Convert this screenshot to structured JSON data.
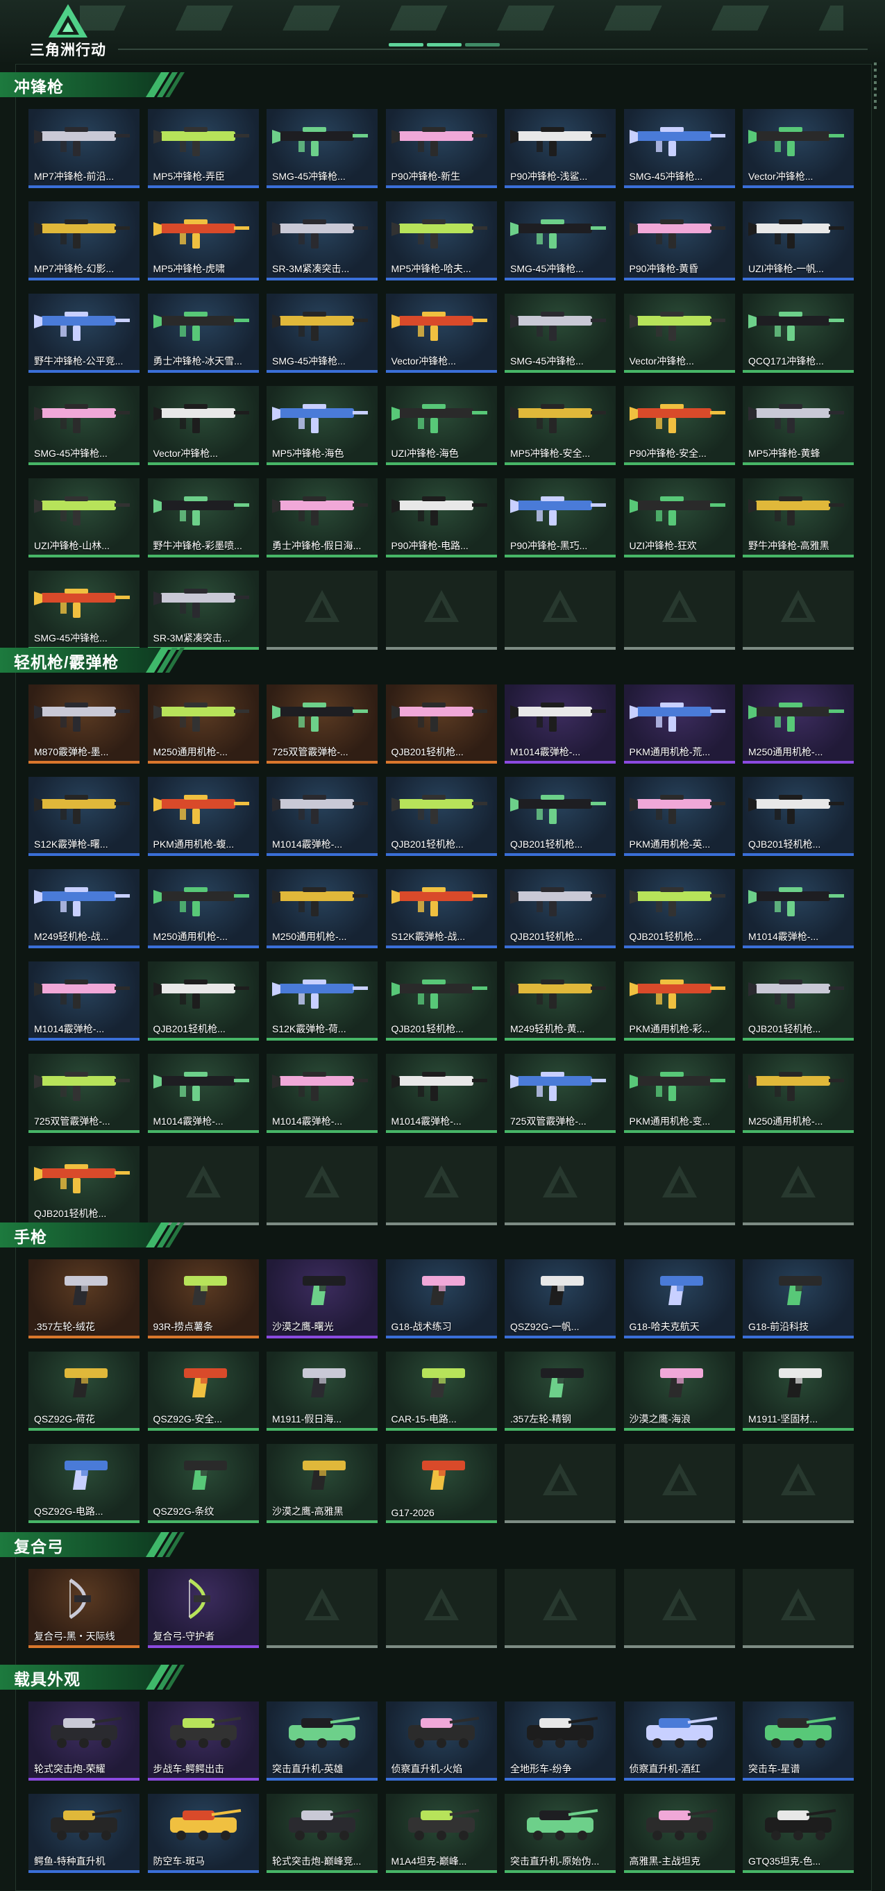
{
  "app": {
    "logo_text": "三角洲行动"
  },
  "colors": {
    "accent": "#47b667",
    "rarity_green": "#47b667",
    "rarity_blue": "#3a6fd8",
    "rarity_purple": "#8b4ae0",
    "rarity_orange": "#d9772c"
  },
  "sections": [
    {
      "title": "冲锋枪",
      "icon": "smg-icon",
      "slots": 42,
      "items": [
        {
          "label": "MP7冲锋枪-前沿...",
          "rarity": "blue"
        },
        {
          "label": "MP5冲锋枪-弄臣",
          "rarity": "blue"
        },
        {
          "label": "SMG-45冲锋枪...",
          "rarity": "blue"
        },
        {
          "label": "P90冲锋枪-新生",
          "rarity": "blue"
        },
        {
          "label": "P90冲锋枪-浅鲨...",
          "rarity": "blue"
        },
        {
          "label": "SMG-45冲锋枪...",
          "rarity": "blue"
        },
        {
          "label": "Vector冲锋枪...",
          "rarity": "blue"
        },
        {
          "label": "MP7冲锋枪-幻影...",
          "rarity": "blue"
        },
        {
          "label": "MP5冲锋枪-虎啸",
          "rarity": "blue"
        },
        {
          "label": "SR-3M紧凑突击...",
          "rarity": "blue"
        },
        {
          "label": "MP5冲锋枪-哈夫...",
          "rarity": "blue"
        },
        {
          "label": "SMG-45冲锋枪...",
          "rarity": "blue"
        },
        {
          "label": "P90冲锋枪-黄昏",
          "rarity": "blue"
        },
        {
          "label": "UZI冲锋枪-一帆...",
          "rarity": "blue"
        },
        {
          "label": "野牛冲锋枪-公平竞...",
          "rarity": "blue"
        },
        {
          "label": "勇士冲锋枪-冰天雪...",
          "rarity": "blue"
        },
        {
          "label": "SMG-45冲锋枪...",
          "rarity": "blue"
        },
        {
          "label": "Vector冲锋枪...",
          "rarity": "blue"
        },
        {
          "label": "SMG-45冲锋枪...",
          "rarity": "green"
        },
        {
          "label": "Vector冲锋枪...",
          "rarity": "green"
        },
        {
          "label": "QCQ171冲锋枪...",
          "rarity": "green"
        },
        {
          "label": "SMG-45冲锋枪...",
          "rarity": "green"
        },
        {
          "label": "Vector冲锋枪...",
          "rarity": "green"
        },
        {
          "label": "MP5冲锋枪-海色",
          "rarity": "green"
        },
        {
          "label": "UZI冲锋枪-海色",
          "rarity": "green"
        },
        {
          "label": "MP5冲锋枪-安全...",
          "rarity": "green"
        },
        {
          "label": "P90冲锋枪-安全...",
          "rarity": "green"
        },
        {
          "label": "MP5冲锋枪-黄蜂",
          "rarity": "green"
        },
        {
          "label": "UZI冲锋枪-山林...",
          "rarity": "green"
        },
        {
          "label": "野牛冲锋枪-彩墨喷...",
          "rarity": "green"
        },
        {
          "label": "勇士冲锋枪-假日海...",
          "rarity": "green"
        },
        {
          "label": "P90冲锋枪-电路...",
          "rarity": "green"
        },
        {
          "label": "P90冲锋枪-黑巧...",
          "rarity": "green"
        },
        {
          "label": "UZI冲锋枪-狂欢",
          "rarity": "green"
        },
        {
          "label": "野牛冲锋枪-高雅黑",
          "rarity": "green"
        },
        {
          "label": "SMG-45冲锋枪...",
          "rarity": "green"
        },
        {
          "label": "SR-3M紧凑突击...",
          "rarity": "green"
        }
      ]
    },
    {
      "title": "轻机枪/霰弹枪",
      "icon": "lmg-icon",
      "slots": 42,
      "items": [
        {
          "label": "M870霰弹枪-墨...",
          "rarity": "orange"
        },
        {
          "label": "M250通用机枪-...",
          "rarity": "orange"
        },
        {
          "label": "725双管霰弹枪-...",
          "rarity": "orange"
        },
        {
          "label": "QJB201轻机枪...",
          "rarity": "orange"
        },
        {
          "label": "M1014霰弹枪-...",
          "rarity": "purple"
        },
        {
          "label": "PKM通用机枪-荒...",
          "rarity": "purple"
        },
        {
          "label": "M250通用机枪-...",
          "rarity": "purple"
        },
        {
          "label": "S12K霰弹枪-曙...",
          "rarity": "blue"
        },
        {
          "label": "PKM通用机枪-蝮...",
          "rarity": "blue"
        },
        {
          "label": "M1014霰弹枪-...",
          "rarity": "blue"
        },
        {
          "label": "QJB201轻机枪...",
          "rarity": "blue"
        },
        {
          "label": "QJB201轻机枪...",
          "rarity": "blue"
        },
        {
          "label": "PKM通用机枪-英...",
          "rarity": "blue"
        },
        {
          "label": "QJB201轻机枪...",
          "rarity": "blue"
        },
        {
          "label": "M249轻机枪-战...",
          "rarity": "blue"
        },
        {
          "label": "M250通用机枪-...",
          "rarity": "blue"
        },
        {
          "label": "M250通用机枪-...",
          "rarity": "blue"
        },
        {
          "label": "S12K霰弹枪-战...",
          "rarity": "blue"
        },
        {
          "label": "QJB201轻机枪...",
          "rarity": "blue"
        },
        {
          "label": "QJB201轻机枪...",
          "rarity": "blue"
        },
        {
          "label": "M1014霰弹枪-...",
          "rarity": "blue"
        },
        {
          "label": "M1014霰弹枪-...",
          "rarity": "blue"
        },
        {
          "label": "QJB201轻机枪...",
          "rarity": "green"
        },
        {
          "label": "S12K霰弹枪-荷...",
          "rarity": "green"
        },
        {
          "label": "QJB201轻机枪...",
          "rarity": "green"
        },
        {
          "label": "M249轻机枪-黄...",
          "rarity": "green"
        },
        {
          "label": "PKM通用机枪-彩...",
          "rarity": "green"
        },
        {
          "label": "QJB201轻机枪...",
          "rarity": "green"
        },
        {
          "label": "725双管霰弹枪-...",
          "rarity": "green"
        },
        {
          "label": "M1014霰弹枪-...",
          "rarity": "green"
        },
        {
          "label": "M1014霰弹枪-...",
          "rarity": "green"
        },
        {
          "label": "M1014霰弹枪-...",
          "rarity": "green"
        },
        {
          "label": "725双管霰弹枪-...",
          "rarity": "green"
        },
        {
          "label": "PKM通用机枪-变...",
          "rarity": "green"
        },
        {
          "label": "M250通用机枪-...",
          "rarity": "green"
        },
        {
          "label": "QJB201轻机枪...",
          "rarity": "green"
        }
      ]
    },
    {
      "title": "手枪",
      "icon": "pistol-icon",
      "slots": 21,
      "items": [
        {
          "label": ".357左轮-绒花",
          "rarity": "orange"
        },
        {
          "label": "93R-捞点薯条",
          "rarity": "orange"
        },
        {
          "label": "沙漠之鹰-曙光",
          "rarity": "purple"
        },
        {
          "label": "G18-战术练习",
          "rarity": "blue"
        },
        {
          "label": "QSZ92G-一帆...",
          "rarity": "blue"
        },
        {
          "label": "G18-哈夫克航天",
          "rarity": "blue"
        },
        {
          "label": "G18-前沿科技",
          "rarity": "blue"
        },
        {
          "label": "QSZ92G-荷花",
          "rarity": "green"
        },
        {
          "label": "QSZ92G-安全...",
          "rarity": "green"
        },
        {
          "label": "M1911-假日海...",
          "rarity": "green"
        },
        {
          "label": "CAR-15-电路...",
          "rarity": "green"
        },
        {
          "label": ".357左轮-精钢",
          "rarity": "green"
        },
        {
          "label": "沙漠之鹰-海浪",
          "rarity": "green"
        },
        {
          "label": "M1911-坚固材...",
          "rarity": "green"
        },
        {
          "label": "QSZ92G-电路...",
          "rarity": "green"
        },
        {
          "label": "QSZ92G-条纹",
          "rarity": "green"
        },
        {
          "label": "沙漠之鹰-高雅黑",
          "rarity": "green"
        },
        {
          "label": "G17-2026",
          "rarity": "green"
        }
      ]
    },
    {
      "title": "复合弓",
      "icon": "bow-icon",
      "slots": 7,
      "items": [
        {
          "label": "复合弓-黑・天际线",
          "rarity": "orange"
        },
        {
          "label": "复合弓-守护者",
          "rarity": "purple"
        }
      ]
    },
    {
      "title": "载具外观",
      "icon": "vehicle-icon",
      "slots": 14,
      "items": [
        {
          "label": "轮式突击炮-荣耀",
          "rarity": "purple"
        },
        {
          "label": "步战车-鳄鳄出击",
          "rarity": "purple"
        },
        {
          "label": "突击直升机-英雄",
          "rarity": "blue"
        },
        {
          "label": "侦察直升机-火焰",
          "rarity": "blue"
        },
        {
          "label": "全地形车-纷争",
          "rarity": "blue"
        },
        {
          "label": "侦察直升机-酒红",
          "rarity": "blue"
        },
        {
          "label": "突击车-星谱",
          "rarity": "blue"
        },
        {
          "label": "鳄鱼-特种直升机",
          "rarity": "blue"
        },
        {
          "label": "防空车-斑马",
          "rarity": "blue"
        },
        {
          "label": "轮式突击炮-巅峰竞...",
          "rarity": "green"
        },
        {
          "label": "M1A4坦克-巅峰...",
          "rarity": "green"
        },
        {
          "label": "突击直升机-原始伪...",
          "rarity": "green"
        },
        {
          "label": "高雅黑-主战坦克",
          "rarity": "green"
        },
        {
          "label": "GTQ35坦克-色...",
          "rarity": "green"
        }
      ]
    }
  ]
}
